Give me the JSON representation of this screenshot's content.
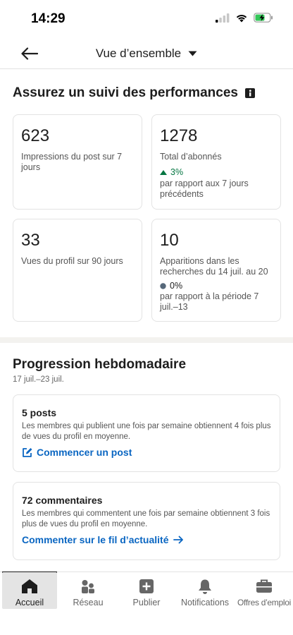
{
  "status_bar": {
    "time": "14:29"
  },
  "header": {
    "title": "Vue d’ensemble"
  },
  "performance": {
    "title": "Assurez un suivi des performances",
    "metrics": [
      {
        "value": "623",
        "label": "Impressions du post sur 7 jours"
      },
      {
        "value": "1278",
        "label": "Total d’abonnés",
        "change": "3%",
        "change_note": "par rapport aux 7 jours précédents"
      },
      {
        "value": "33",
        "label": "Vues du profil sur 90 jours"
      },
      {
        "value": "10",
        "label": "Apparitions dans les recherches du 14 juil. au 20",
        "change": "0%",
        "change_note": "par rapport à la période 7 juil.–13"
      }
    ]
  },
  "weekly": {
    "title": "Progression hebdomadaire",
    "date_range": "17 juil.–23 juil.",
    "tips": [
      {
        "title": "5 posts",
        "desc": "Les membres qui publient une fois par semaine obtiennent 4 fois plus de vues du profil en moyenne.",
        "link": "Commencer un post"
      },
      {
        "title": "72 commentaires",
        "desc": "Les membres qui commentent une fois par semaine obtiennent 3 fois plus de vues du profil en moyenne.",
        "link": "Commenter sur le fil d’actualité"
      }
    ]
  },
  "bottom_nav": {
    "items": [
      {
        "label": "Accueil",
        "icon": "home-icon"
      },
      {
        "label": "Réseau",
        "icon": "network-icon"
      },
      {
        "label": "Publier",
        "icon": "post-icon"
      },
      {
        "label": "Notifications",
        "icon": "bell-icon"
      },
      {
        "label": "Offres d’emploi",
        "icon": "briefcase-icon"
      }
    ]
  },
  "colors": {
    "accent": "#0a66c2",
    "positive": "#057642",
    "neutral_dot": "#56687a",
    "text": "#1d1d1d",
    "battery": "#34c759"
  }
}
